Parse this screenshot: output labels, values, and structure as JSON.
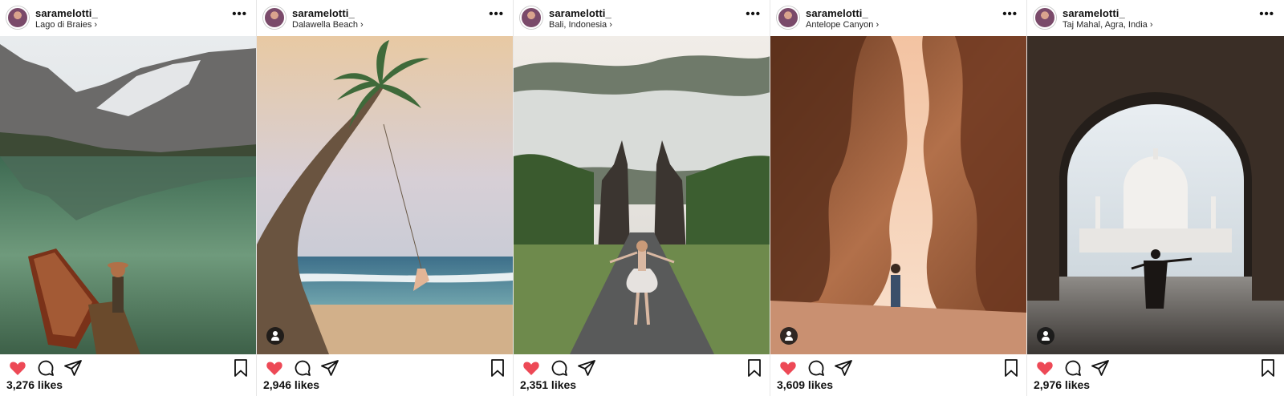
{
  "posts": [
    {
      "username": "saramelotti_",
      "location": "Lago di Braies",
      "likes": "3,276 likes",
      "liked": true,
      "user_tag": false
    },
    {
      "username": "saramelotti_",
      "location": "Dalawella Beach",
      "likes": "2,946 likes",
      "liked": true,
      "user_tag": true
    },
    {
      "username": "saramelotti_",
      "location": "Bali, Indonesia",
      "likes": "2,351 likes",
      "liked": true,
      "user_tag": false
    },
    {
      "username": "saramelotti_",
      "location": "Antelope Canyon",
      "likes": "3,609 likes",
      "liked": true,
      "user_tag": true
    },
    {
      "username": "saramelotti_",
      "location": "Taj Mahal, Agra, India",
      "likes": "2,976 likes",
      "liked": true,
      "user_tag": true
    }
  ],
  "icons": {
    "more": "more-icon",
    "heart": "heart-icon",
    "comment": "comment-icon",
    "share": "share-icon",
    "bookmark": "bookmark-icon",
    "chevron": "chevron-right-icon",
    "user_tag": "user-tag-icon"
  },
  "colors": {
    "like_red": "#ed4956"
  }
}
